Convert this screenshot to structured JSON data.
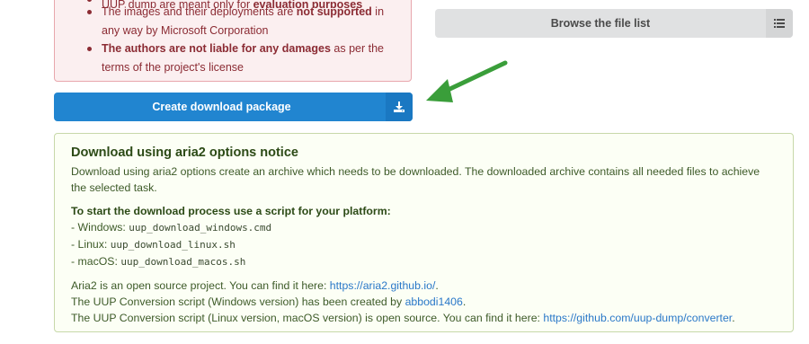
{
  "warning": {
    "items": [
      {
        "prefix": "UUP dump are meant only for ",
        "bold": "evaluation purposes",
        "suffix": ""
      },
      {
        "prefix": "The images and their deployments are ",
        "bold": "not supported",
        "suffix": " in any way by Microsoft Corporation"
      },
      {
        "prefix": "",
        "bold": "The authors are not liable for any damages",
        "suffix": " as per the terms of the project's license"
      }
    ]
  },
  "browse_button": {
    "label": "Browse the file list",
    "icon": "list-icon"
  },
  "create_button": {
    "label": "Create download package",
    "icon": "download-icon"
  },
  "annotation": {
    "icon": "arrow-pointer",
    "color": "#3a9e3a"
  },
  "notice": {
    "title": "Download using aria2 options notice",
    "description": "Download using aria2 options create an archive which needs to be downloaded. The downloaded archive contains all needed files to achieve the selected task.",
    "platform_heading": "To start the download process use a script for your platform:",
    "scripts": [
      {
        "platform": "- Windows: ",
        "file": "uup_download_windows.cmd"
      },
      {
        "platform": "- Linux: ",
        "file": "uup_download_linux.sh"
      },
      {
        "platform": "- macOS: ",
        "file": "uup_download_macos.sh"
      }
    ],
    "aria2_text": "Aria2 is an open source project. You can find it here: ",
    "aria2_link": "https://aria2.github.io/",
    "aria2_end": ".",
    "conversion_win_text": "The UUP Conversion script (Windows version) has been created by ",
    "conversion_win_link": "abbodi1406",
    "conversion_win_end": ".",
    "conversion_linux_text": "The UUP Conversion script (Linux version, macOS version) is open source. You can find it here: ",
    "conversion_linux_link": "https://github.com/uup-dump/converter",
    "conversion_linux_end": "."
  },
  "colors": {
    "primary": "#2185d0",
    "notice_bg": "#fcfff5",
    "warning_bg": "#fbeff0",
    "arrow": "#3a9e3a"
  }
}
